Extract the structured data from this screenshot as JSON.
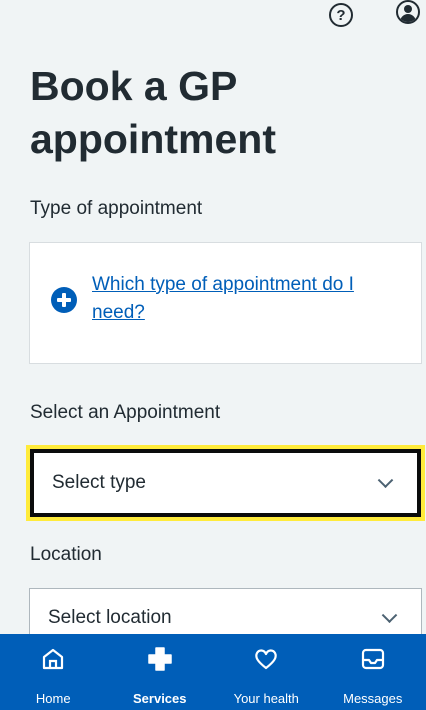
{
  "header": {
    "help_icon": "help-icon",
    "account_icon": "account-icon",
    "help_glyph": "?"
  },
  "page": {
    "title": "Book a GP appointment"
  },
  "appointment_type": {
    "label": "Type of appointment",
    "help_link": "Which type of appointment do I need?",
    "help_link_icon": "plus-circle-icon"
  },
  "appointment_select": {
    "label": "Select an Appointment",
    "value": "Select type"
  },
  "location_select": {
    "label": "Location",
    "value": "Select location"
  },
  "nav": {
    "items": [
      {
        "label": "Home",
        "icon": "home-icon",
        "active": false
      },
      {
        "label": "Services",
        "icon": "plus-cross-icon",
        "active": true
      },
      {
        "label": "Your health",
        "icon": "heart-icon",
        "active": false
      },
      {
        "label": "Messages",
        "icon": "inbox-icon",
        "active": false
      }
    ]
  },
  "colors": {
    "nhs_blue": "#005eb8",
    "focus_yellow": "#ffeb3b",
    "background": "#f0f4f5",
    "text": "#212b32"
  }
}
